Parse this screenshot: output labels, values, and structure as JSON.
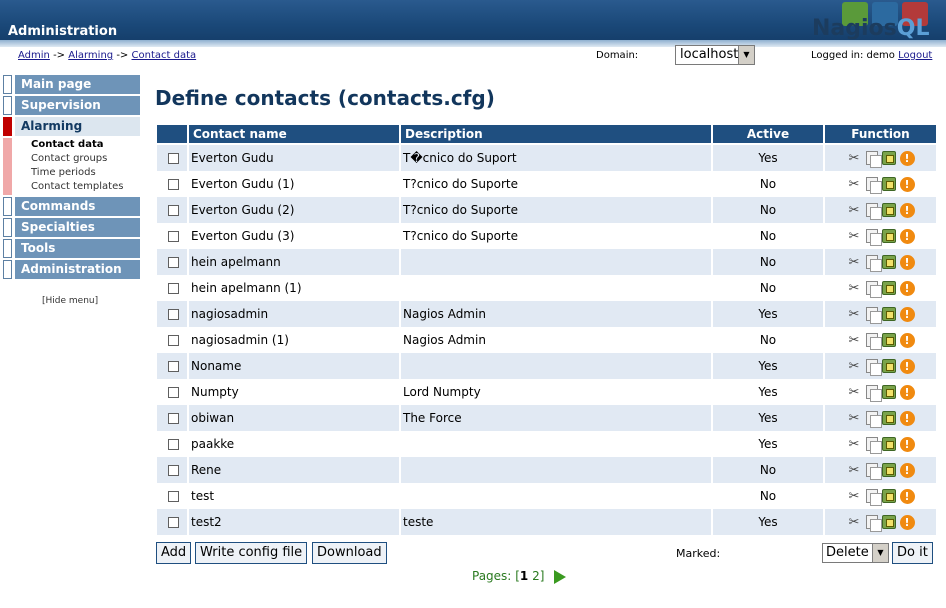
{
  "header": {
    "title": "Administration",
    "logo_text_main": "Nagios",
    "logo_text_accent": "QL"
  },
  "breadcrumb": {
    "items": [
      "Admin",
      "Alarming",
      "Contact data"
    ],
    "separator": "->"
  },
  "domain": {
    "label": "Domain:",
    "value": "localhost"
  },
  "login": {
    "text": "Logged in: demo",
    "logout": "Logout"
  },
  "sidebar": {
    "items": [
      {
        "label": "Main page"
      },
      {
        "label": "Supervision"
      },
      {
        "label": "Alarming",
        "active": true
      },
      {
        "label": "Commands"
      },
      {
        "label": "Specialties"
      },
      {
        "label": "Tools"
      },
      {
        "label": "Administration"
      }
    ],
    "submenu": [
      {
        "label": "Contact data",
        "active": true
      },
      {
        "label": "Contact groups"
      },
      {
        "label": "Time periods"
      },
      {
        "label": "Contact templates"
      }
    ],
    "hide_menu": "[Hide menu]"
  },
  "main": {
    "title": "Define contacts (contacts.cfg)",
    "table": {
      "headers": [
        "Contact name",
        "Description",
        "Active",
        "Function"
      ],
      "rows": [
        {
          "name": "Everton Gudu",
          "description": "T�cnico do Suport",
          "active": "Yes"
        },
        {
          "name": "Everton Gudu (1)",
          "description": "T?cnico do Suporte",
          "active": "No"
        },
        {
          "name": "Everton Gudu (2)",
          "description": "T?cnico do Suporte",
          "active": "No"
        },
        {
          "name": "Everton Gudu (3)",
          "description": "T?cnico do Suporte",
          "active": "No"
        },
        {
          "name": "hein apelmann",
          "description": "",
          "active": "No"
        },
        {
          "name": "hein apelmann (1)",
          "description": "",
          "active": "No"
        },
        {
          "name": "nagiosadmin",
          "description": "Nagios Admin",
          "active": "Yes"
        },
        {
          "name": "nagiosadmin (1)",
          "description": "Nagios Admin",
          "active": "No"
        },
        {
          "name": "Noname",
          "description": "",
          "active": "Yes"
        },
        {
          "name": "Numpty",
          "description": "Lord Numpty",
          "active": "Yes"
        },
        {
          "name": "obiwan",
          "description": "The Force",
          "active": "Yes"
        },
        {
          "name": "paakke",
          "description": "",
          "active": "Yes"
        },
        {
          "name": "Rene",
          "description": "",
          "active": "No"
        },
        {
          "name": "test",
          "description": "",
          "active": "No"
        },
        {
          "name": "test2",
          "description": "teste",
          "active": "Yes"
        }
      ]
    },
    "buttons": {
      "add": "Add",
      "write_config": "Write config file",
      "download": "Download",
      "marked_label": "Marked:",
      "marked_action": "Delete",
      "do_it": "Do it"
    },
    "pages": {
      "label": "Pages:",
      "open": "[",
      "current": "1",
      "other": "2",
      "close": "]"
    }
  },
  "colors": {
    "header_bg": "#1a4878",
    "menu_bg": "#6e94b8",
    "active_marker": "#c00000",
    "table_header": "#1f4f80",
    "row_alt": "#e1e9f3",
    "pages_green": "#2a7a1f"
  }
}
